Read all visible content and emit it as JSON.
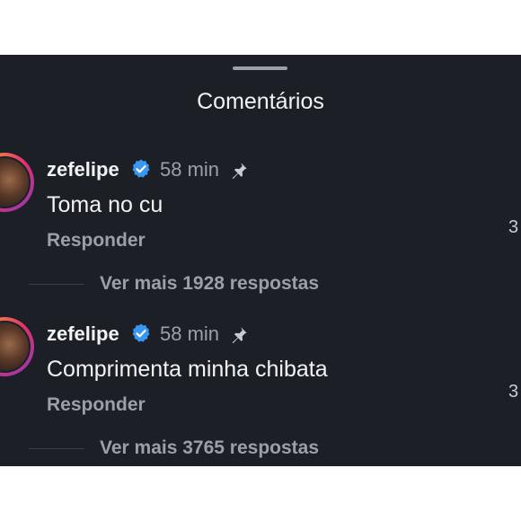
{
  "sheet": {
    "title": "Comentários"
  },
  "comments": [
    {
      "username": "zefelipe",
      "time": "58 min",
      "text": "Toma no cu",
      "reply_label": "Responder",
      "likes_partial": "3",
      "view_replies": "Ver mais 1928 respostas"
    },
    {
      "username": "zefelipe",
      "time": "58 min",
      "text": "Comprimenta minha chibata",
      "reply_label": "Responder",
      "likes_partial": "3",
      "view_replies": "Ver mais 3765 respostas"
    }
  ],
  "icons": {
    "verified": "verified-badge-icon",
    "pin": "pin-icon"
  },
  "colors": {
    "background": "#1c1f25",
    "verified": "#3897f0",
    "secondary_text": "#9aa0a8"
  }
}
